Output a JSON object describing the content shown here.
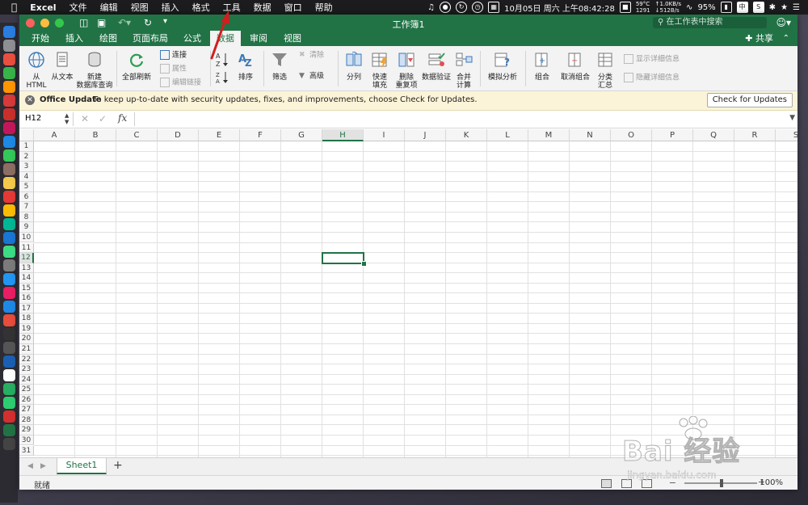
{
  "menubar": {
    "app": "Excel",
    "items": [
      "文件",
      "编辑",
      "视图",
      "插入",
      "格式",
      "工具",
      "数据",
      "窗口",
      "帮助"
    ],
    "temp": "59°C",
    "fan": "1291",
    "net_up": "↑1.0KB/s",
    "net_down": "↓512B/s",
    "date": "10月05日 周六 上午08:42:28",
    "battery": "95%",
    "input_method": "中"
  },
  "window": {
    "title": "工作簿1",
    "search_placeholder": "在工作表中搜索",
    "share_label": "共享"
  },
  "tabs": [
    "开始",
    "插入",
    "绘图",
    "页面布局",
    "公式",
    "数据",
    "审阅",
    "视图"
  ],
  "active_tab": "数据",
  "ribbon": {
    "from_html_1": "从",
    "from_html_2": "HTML",
    "from_text": "从文本",
    "new_query_1": "新建",
    "new_query_2": "数据库查询",
    "refresh_all": "全部刷新",
    "connections": "连接",
    "properties": "属性",
    "edit_links": "编辑链接",
    "sort": "排序",
    "filter": "筛选",
    "clear": "清除",
    "advanced": "高级",
    "text_to_columns": "分列",
    "flash_fill_1": "快速",
    "flash_fill_2": "填充",
    "remove_dup_1": "删除",
    "remove_dup_2": "重复项",
    "data_validation": "数据验证",
    "consolidate_1": "合并",
    "consolidate_2": "计算",
    "what_if": "模拟分析",
    "group": "组合",
    "ungroup": "取消组合",
    "subtotal_1": "分类",
    "subtotal_2": "汇总",
    "show_detail": "显示详细信息",
    "hide_detail": "隐藏详细信息"
  },
  "update_bar": {
    "title": "Office Update",
    "message": "To keep up-to-date with security updates, fixes, and improvements, choose Check for Updates.",
    "button": "Check for Updates"
  },
  "formula_bar": {
    "name_box": "H12",
    "fx": "fx",
    "formula": ""
  },
  "grid": {
    "columns": [
      "A",
      "B",
      "C",
      "D",
      "E",
      "F",
      "G",
      "H",
      "I",
      "J",
      "K",
      "L",
      "M",
      "N",
      "O",
      "P",
      "Q",
      "R",
      "S"
    ],
    "rows": [
      "1",
      "2",
      "3",
      "4",
      "5",
      "6",
      "7",
      "8",
      "9",
      "10",
      "11",
      "12",
      "13",
      "14",
      "15",
      "16",
      "17",
      "18",
      "19",
      "20",
      "21",
      "22",
      "23",
      "24",
      "25",
      "26",
      "27",
      "28",
      "29",
      "30",
      "31"
    ],
    "selected_col": "H",
    "selected_row": "12"
  },
  "sheets": [
    "Sheet1"
  ],
  "status": {
    "text": "就绪",
    "zoom": "100%"
  },
  "watermark": {
    "text": "Bai 经验",
    "url": "jingyan.baidu.com"
  },
  "dock_colors": [
    "#2a7de1",
    "#8e8e93",
    "#e94f3f",
    "#38b34a",
    "#ff9500",
    "#d63a3a",
    "#c9302c",
    "#c2185b",
    "#1e88e5",
    "#34c759",
    "#8d6e63",
    "#f2c94c",
    "#e53935",
    "#fbbc05",
    "#00b894",
    "#1976d2",
    "#3ddc84",
    "#7b7b7b",
    "#2196f3",
    "#e91e63",
    "#1e88e5",
    "#e74c3c",
    "#333333",
    "#555555",
    "#1b5fb3",
    "#ffffff",
    "#27ae60",
    "#2ecc71",
    "#d32f2f",
    "#217346",
    "#444444"
  ]
}
